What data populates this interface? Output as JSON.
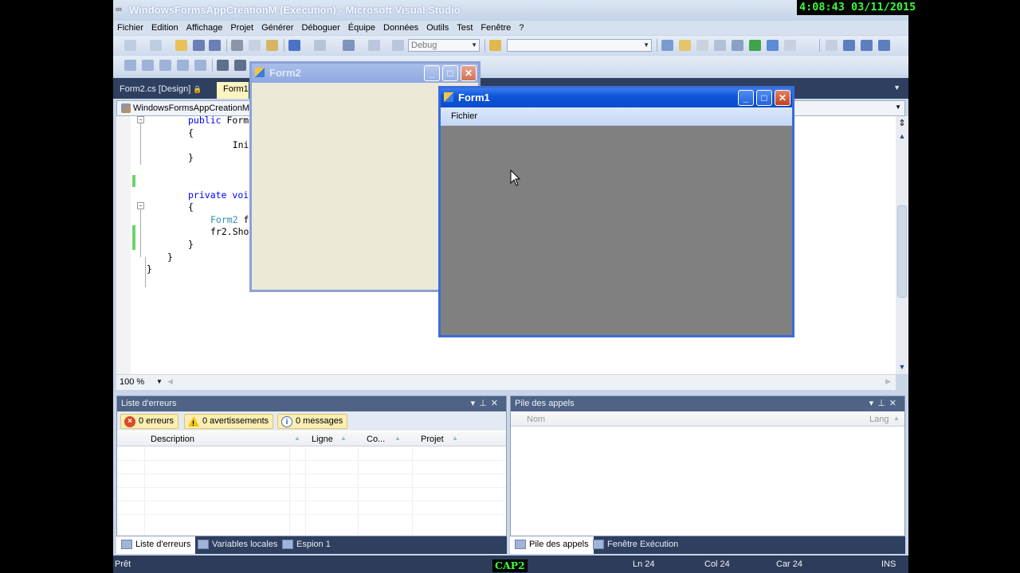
{
  "window": {
    "title": "WindowsFormsAppCreationM (Exécution) - Microsoft Visual Studio"
  },
  "menu": [
    "Fichier",
    "Edition",
    "Affichage",
    "Projet",
    "Générer",
    "Déboguer",
    "Équipe",
    "Données",
    "Outils",
    "Test",
    "Fenêtre",
    "?"
  ],
  "toolbar": {
    "config_combo": "Debug",
    "find_combo": ""
  },
  "doc_tabs": [
    {
      "label": "Form2.cs [Design]",
      "lock": "🔒"
    },
    {
      "label": "Form1."
    }
  ],
  "editor": {
    "nav_combo": "WindowsFormsAppCreationM.F",
    "zoom": "100 %",
    "code_lines": [
      "public Form",
      "{",
      "    Initial",
      "}",
      "",
      "",
      "private voi",
      "{",
      "    Form2 f",
      "    fr2.Sho",
      "}",
      "}",
      "}"
    ]
  },
  "forms": {
    "form2": {
      "title": "Form2"
    },
    "form1": {
      "title": "Form1",
      "menu_item": "Fichier"
    }
  },
  "error_list": {
    "title": "Liste d'erreurs",
    "errors": "0 erreurs",
    "warnings": "0 avertissements",
    "messages": "0 messages",
    "columns": [
      "Description",
      "Ligne",
      "Co...",
      "Projet"
    ]
  },
  "call_stack": {
    "title": "Pile des appels",
    "columns": [
      "Nom",
      "Lang"
    ]
  },
  "bottom_tabs_left": [
    "Liste d'erreurs",
    "Variables locales",
    "Espion 1"
  ],
  "bottom_tabs_right": [
    "Pile des appels",
    "Fenêtre Exécution"
  ],
  "status": {
    "ready": "Prêt",
    "ln": "Ln 24",
    "col": "Col 24",
    "car": "Car 24",
    "ins": "INS"
  },
  "overlay": {
    "clock": "4:08:43  03/11/2015",
    "cap": "CAP2"
  }
}
